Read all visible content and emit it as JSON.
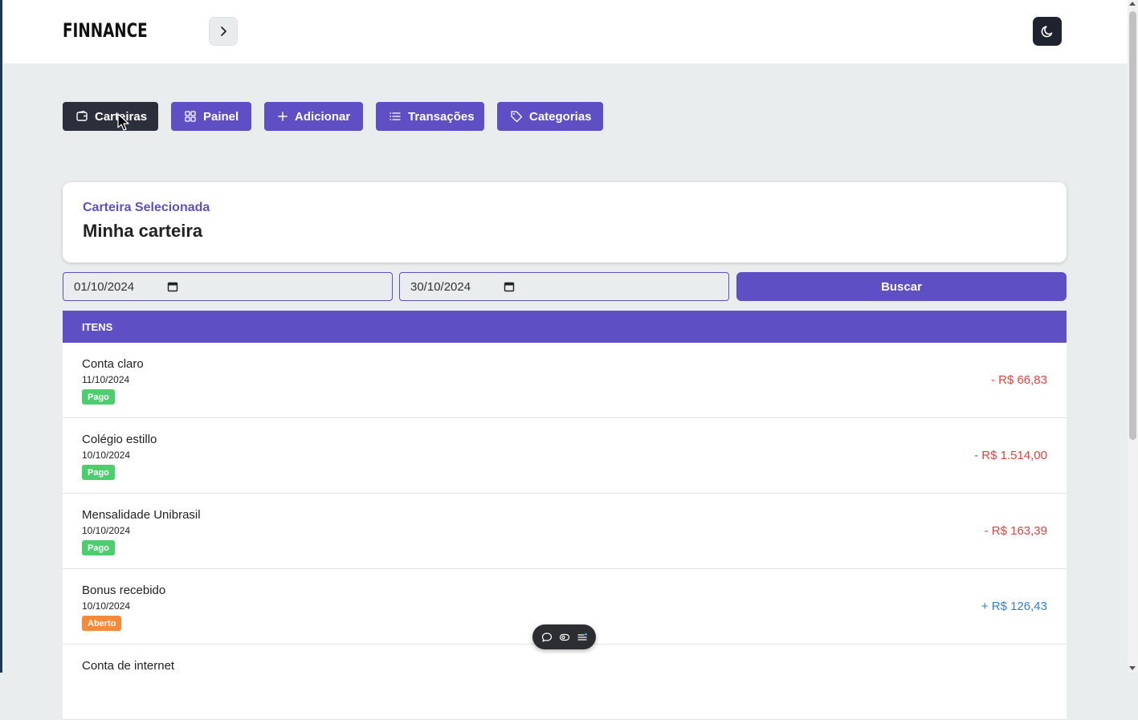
{
  "app": {
    "brand": "FINNANCE"
  },
  "header": {
    "collapse_icon": "chevron-right-icon",
    "theme_icon": "moon-icon"
  },
  "nav": [
    {
      "label": "Carteiras",
      "icon": "wallet-icon",
      "active": true
    },
    {
      "label": "Painel",
      "icon": "grid-icon",
      "active": false
    },
    {
      "label": "Adicionar",
      "icon": "plus-icon",
      "active": false
    },
    {
      "label": "Transações",
      "icon": "list-icon",
      "active": false
    },
    {
      "label": "Categorias",
      "icon": "tag-icon",
      "active": false
    }
  ],
  "wallet": {
    "subtitle": "Carteira Selecionada",
    "name": "Minha carteira"
  },
  "filters": {
    "start_date": "01/10/2024",
    "end_date": "30/10/2024",
    "search_label": "Buscar"
  },
  "table": {
    "header": "ITENS",
    "rows": [
      {
        "name": "Conta claro",
        "date": "11/10/2024",
        "status": "Pago",
        "amount": "- R$ 66,83"
      },
      {
        "name": "Colégio estillo",
        "date": "10/10/2024",
        "status": "Pago",
        "amount": "- R$ 1.514,00"
      },
      {
        "name": "Mensalidade Unibrasil",
        "date": "10/10/2024",
        "status": "Pago",
        "amount": "- R$ 163,39"
      },
      {
        "name": "Bonus recebido",
        "date": "10/10/2024",
        "status": "Aberto",
        "amount": "+ R$ 126,43"
      },
      {
        "name": "Conta de internet",
        "date": "",
        "status": "",
        "amount": ""
      }
    ]
  },
  "colors": {
    "accent": "#5e4fc4",
    "active_nav": "#2b2e3b",
    "paid_badge": "#4cce6e",
    "open_badge": "#f58a3a",
    "expense": "#e0433d",
    "income": "#2f7fd8"
  },
  "floating_toolbar": {
    "icons": [
      "chat-icon",
      "eye-icon",
      "menu-icon"
    ]
  }
}
